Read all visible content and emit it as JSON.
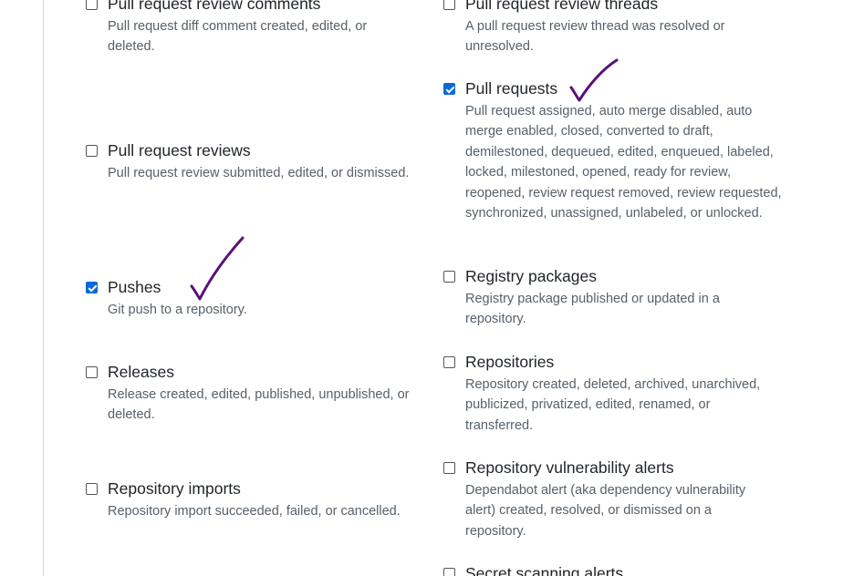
{
  "left_column": [
    {
      "title": "Pull request review comments",
      "description": "Pull request diff comment created, edited, or deleted.",
      "checked": false
    },
    {
      "title": "Pull request reviews",
      "description": "Pull request review submitted, edited, or dismissed.",
      "checked": false
    },
    {
      "title": "Pushes",
      "description": "Git push to a repository.",
      "checked": true
    },
    {
      "title": "Releases",
      "description": "Release created, edited, published, unpublished, or deleted.",
      "checked": false
    },
    {
      "title": "Repository imports",
      "description": "Repository import succeeded, failed, or cancelled.",
      "checked": false
    }
  ],
  "right_column": [
    {
      "title": "Pull request review threads",
      "description": "A pull request review thread was resolved or unresolved.",
      "checked": false
    },
    {
      "title": "Pull requests",
      "description": "Pull request assigned, auto merge disabled, auto merge enabled, closed, converted to draft, demilestoned, dequeued, edited, enqueued, labeled, locked, milestoned, opened, ready for review, reopened, review request removed, review requested, synchronized, unassigned, unlabeled, or unlocked.",
      "checked": true
    },
    {
      "title": "Registry packages",
      "description": "Registry package published or updated in a repository.",
      "checked": false
    },
    {
      "title": "Repositories",
      "description": "Repository created, deleted, archived, unarchived, publicized, privatized, edited, renamed, or transferred.",
      "checked": false
    },
    {
      "title": "Repository vulnerability alerts",
      "description": "Dependabot alert (aka dependency vulnerability alert) created, resolved, or dismissed on a repository.",
      "checked": false
    },
    {
      "title": "Secret scanning alerts",
      "description": "",
      "checked": false
    }
  ],
  "colors": {
    "checkbox_checked": "#0969da",
    "annotation": "#5b0f7a",
    "description_text": "#57606a"
  }
}
